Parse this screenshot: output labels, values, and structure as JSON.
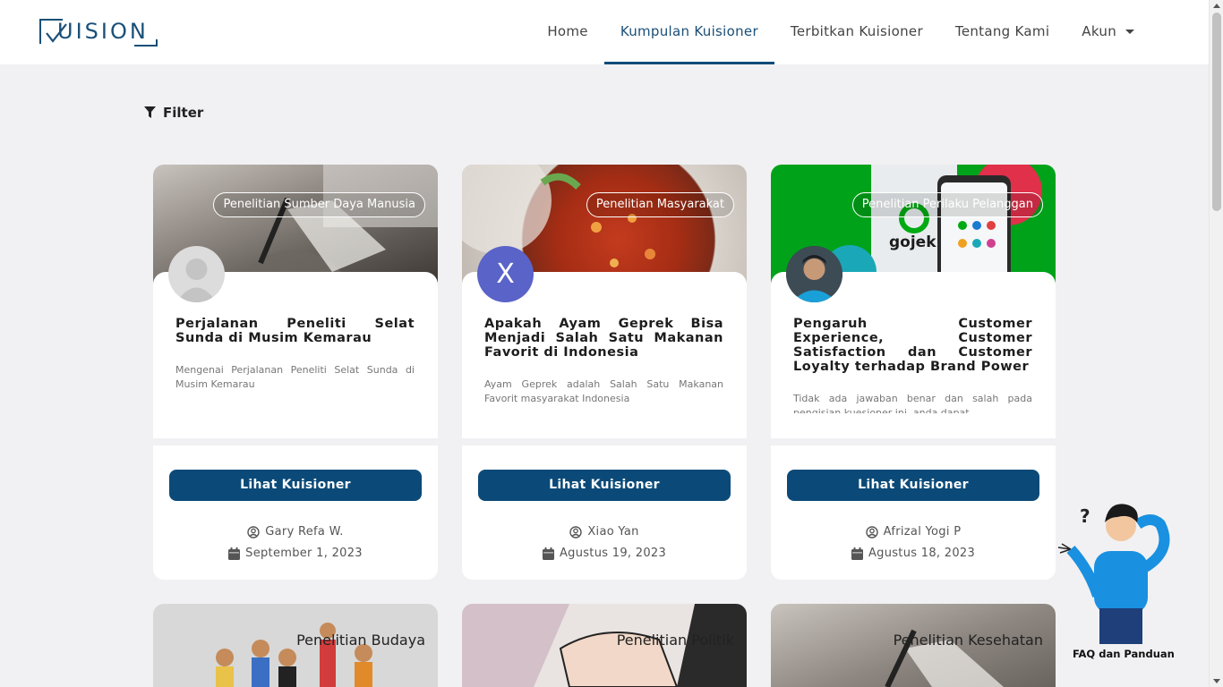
{
  "brand": {
    "logo_text": "UISION"
  },
  "nav": {
    "items": [
      {
        "label": "Home"
      },
      {
        "label": "Kumpulan Kuisioner"
      },
      {
        "label": "Terbitkan Kuisioner"
      },
      {
        "label": "Tentang Kami"
      },
      {
        "label": "Akun"
      }
    ],
    "active_index": 1
  },
  "filter": {
    "label": "Filter"
  },
  "cards": [
    {
      "tag": "Penelitian Sumber Daya Manusia",
      "title": "Perjalanan Peneliti Selat Sunda di Musim Kemarau",
      "description": "Mengenai Perjalanan Peneliti Selat Sunda di Musim Kemarau",
      "button": "Lihat Kuisioner",
      "author": "Gary Refa W.",
      "date": "September 1, 2023",
      "avatar": "default-avatar"
    },
    {
      "tag": "Penelitian Masyarakat",
      "title": "Apakah Ayam Geprek Bisa Menjadi Salah Satu Makanan Favorit di Indonesia",
      "description": "Ayam Geprek adalah Salah Satu Makanan Favorit masyarakat Indonesia",
      "button": "Lihat Kuisioner",
      "author": "Xiao Yan",
      "date": "Agustus 19, 2023",
      "avatar_letter": "X"
    },
    {
      "tag": "Penelitian Perilaku Pelanggan",
      "title": "Pengaruh Customer Experience, Customer Satisfaction dan Customer Loyalty terhadap Brand Power",
      "description": "Tidak ada jawaban benar dan salah pada pengisian kuesioner ini, anda dapat",
      "cover_text": "gojek",
      "button": "Lihat Kuisioner",
      "author": "Afrizal Yogi P",
      "date": "Agustus 18, 2023",
      "avatar": "photo-avatar"
    }
  ],
  "cards_row2": [
    {
      "tag": "Penelitian Budaya"
    },
    {
      "tag": "Penelitian Politik"
    },
    {
      "tag": "Penelitian Kesehatan"
    }
  ],
  "faq": {
    "label": "FAQ dan Panduan"
  },
  "colors": {
    "primary": "#0b4a78",
    "avatar_x": "#5a63c8",
    "gojek_green": "#00aa13"
  }
}
